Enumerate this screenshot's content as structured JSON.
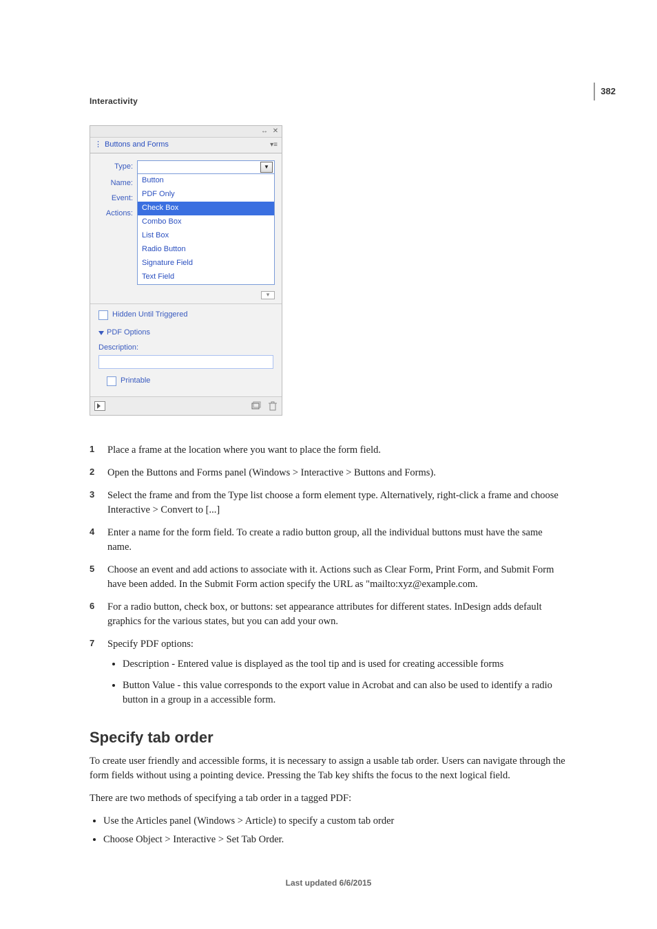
{
  "page_number": "382",
  "section_title": "Interactivity",
  "panel": {
    "tab_label": "Buttons and Forms",
    "rows": {
      "type": "Type:",
      "name": "Name:",
      "event": "Event:",
      "actions": "Actions:"
    },
    "dropdown": {
      "item_button": "Button",
      "section_head": "PDF Only",
      "items": [
        "Check Box",
        "Combo Box",
        "List Box",
        "Radio Button",
        "Signature Field",
        "Text Field"
      ]
    },
    "hidden_label": "Hidden Until Triggered",
    "pdf_section": "PDF Options",
    "description_label": "Description:",
    "printable_label": "Printable"
  },
  "steps": [
    "Place a frame at the location where you want to place the form field.",
    "Open the Buttons and Forms panel (Windows > Interactive > Buttons and Forms).",
    "Select the frame and from the Type list choose a form element type. Alternatively, right-click a frame and choose Interactive > Convert to [...]",
    "Enter a name for the form field. To create a radio button group, all the individual buttons must have the same name.",
    "Choose an event and add actions to associate with it. Actions such as Clear Form, Print Form, and Submit Form have been added. In the Submit Form action specify the URL as \"mailto:xyz@example.com.",
    "For a radio button, check box, or buttons: set appearance attributes for different states. InDesign adds default graphics for the various states, but you can add your own.",
    "Specify PDF options:"
  ],
  "pdf_options_bullets": [
    "Description - Entered value is displayed as the tool tip and is used for creating accessible forms",
    "Button Value - this value corresponds to the export value in Acrobat and can also be used to identify a radio button in a group in a accessible form."
  ],
  "h2": "Specify tab order",
  "para1": "To create user friendly and accessible forms, it is necessary to assign a usable tab order. Users can navigate through the form fields without using a pointing device. Pressing the Tab key shifts the focus to the next logical field.",
  "para2": "There are two methods of specifying a tab order in a tagged PDF:",
  "tab_methods": [
    "Use the Articles panel (Windows > Article) to specify a custom tab order",
    "Choose Object > Interactive > Set Tab Order."
  ],
  "footer": "Last updated 6/6/2015"
}
